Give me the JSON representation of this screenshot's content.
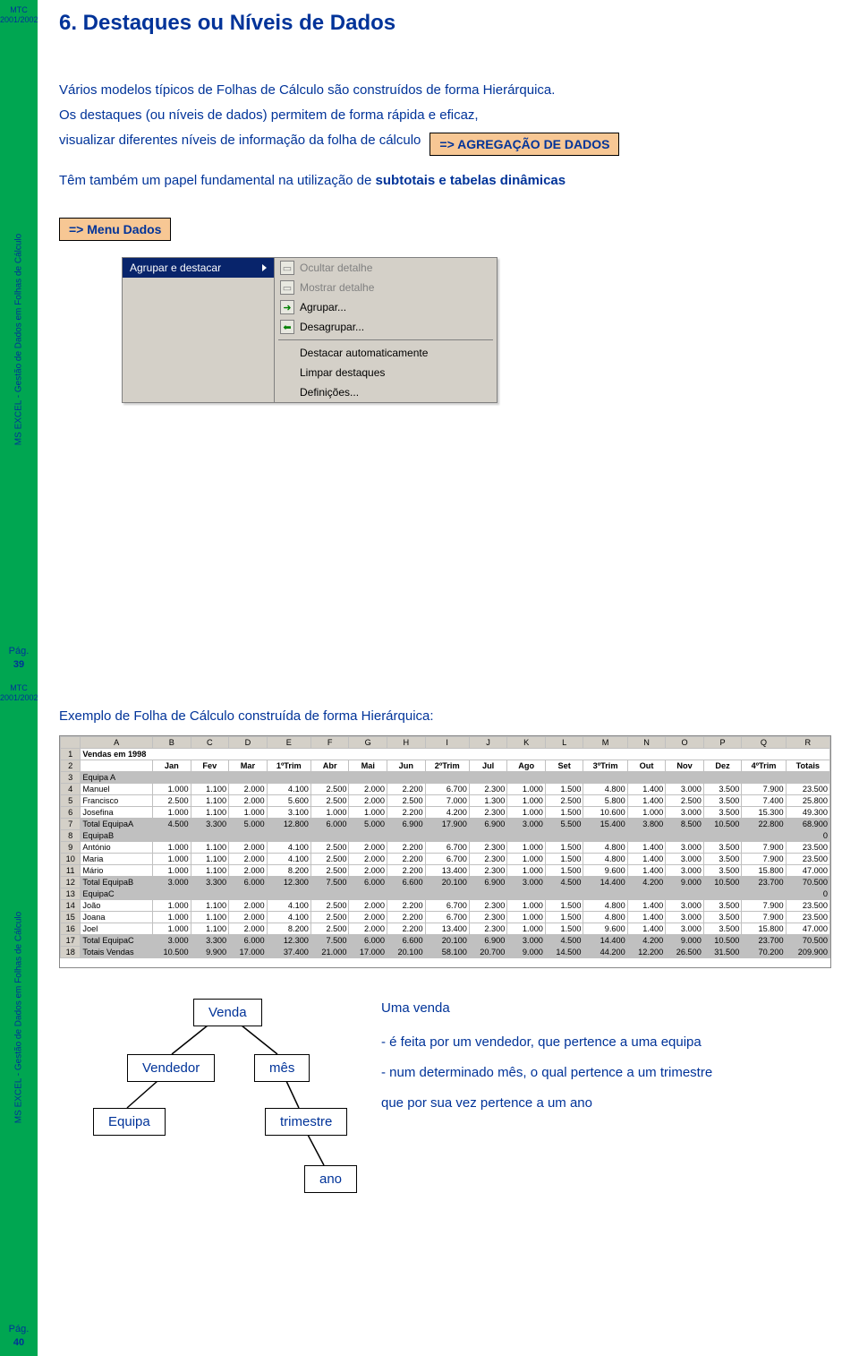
{
  "sidebar": {
    "course": "MTC",
    "year": "2001/2002",
    "subject": "MS EXCEL - Gestão de Dados em Folhas de Cálculo",
    "pag_label": "Pág."
  },
  "slide39": {
    "page": "39",
    "title": "6. Destaques ou Níveis de Dados",
    "p1": "Vários modelos típicos de Folhas de Cálculo são construídos de forma Hierárquica.",
    "p2a": "Os destaques (ou níveis de dados) permitem de forma rápida e eficaz,",
    "p2b": "visualizar diferentes níveis de informação da folha de cálculo",
    "callout_agreg": "=> AGREGAÇÃO DE DADOS",
    "p3a": "Têm também um papel fundamental na utilização de ",
    "p3b": "subtotais e tabelas dinâmicas",
    "callout_menu": "=> Menu Dados",
    "menu": {
      "left_item": "Agrupar e destacar",
      "right": {
        "ocultar": "Ocultar detalhe",
        "mostrar": "Mostrar detalhe",
        "agrupar": "Agrupar...",
        "desagrupar": "Desagrupar...",
        "destacar": "Destacar automaticamente",
        "limpar": "Limpar destaques",
        "def": "Definições..."
      }
    }
  },
  "slide40": {
    "page": "40",
    "heading": "Exemplo de Folha de Cálculo construída de forma Hierárquica:",
    "diagram": {
      "venda": "Venda",
      "vendedor": "Vendedor",
      "mes": "mês",
      "equipa": "Equipa",
      "trimestre": "trimestre",
      "ano": "ano",
      "uma_venda": "Uma venda",
      "line1": "- é feita por um vendedor, que pertence a uma equipa",
      "line2": "- num determinado mês, o qual pertence a um trimestre",
      "line3": "que por sua vez pertence a um ano"
    }
  },
  "chart_data": {
    "type": "table",
    "title": "Vendas em 1998",
    "columns": [
      "",
      "Jan",
      "Fev",
      "Mar",
      "1ºTrim",
      "Abr",
      "Mai",
      "Jun",
      "2ºTrim",
      "Jul",
      "Ago",
      "Set",
      "3ºTrim",
      "Out",
      "Nov",
      "Dez",
      "4ºTrim",
      "Totais"
    ],
    "rows": [
      {
        "n": 3,
        "label": "Equipa A",
        "grey": true,
        "vals": [
          "",
          "",
          "",
          "",
          "",
          "",
          "",
          "",
          "",
          "",
          "",
          "",
          "",
          "",
          "",
          "",
          ""
        ]
      },
      {
        "n": 4,
        "label": "Manuel",
        "vals": [
          "1.000",
          "1.100",
          "2.000",
          "4.100",
          "2.500",
          "2.000",
          "2.200",
          "6.700",
          "2.300",
          "1.000",
          "1.500",
          "4.800",
          "1.400",
          "3.000",
          "3.500",
          "7.900",
          "23.500"
        ]
      },
      {
        "n": 5,
        "label": "Francisco",
        "vals": [
          "2.500",
          "1.100",
          "2.000",
          "5.600",
          "2.500",
          "2.000",
          "2.500",
          "7.000",
          "1.300",
          "1.000",
          "2.500",
          "5.800",
          "1.400",
          "2.500",
          "3.500",
          "7.400",
          "25.800"
        ]
      },
      {
        "n": 6,
        "label": "Josefina",
        "vals": [
          "1.000",
          "1.100",
          "1.000",
          "3.100",
          "1.000",
          "1.000",
          "2.200",
          "4.200",
          "2.300",
          "1.000",
          "1.500",
          "10.600",
          "1.000",
          "3.000",
          "3.500",
          "15.300",
          "49.300"
        ]
      },
      {
        "n": 7,
        "label": "Total EquipaA",
        "grey": true,
        "vals": [
          "4.500",
          "3.300",
          "5.000",
          "12.800",
          "6.000",
          "5.000",
          "6.900",
          "17.900",
          "6.900",
          "3.000",
          "5.500",
          "15.400",
          "3.800",
          "8.500",
          "10.500",
          "22.800",
          "68.900"
        ]
      },
      {
        "n": 8,
        "label": "EquipaB",
        "grey": true,
        "vals": [
          "",
          "",
          "",
          "",
          "",
          "",
          "",
          "",
          "",
          "",
          "",
          "",
          "",
          "",
          "",
          "",
          "0"
        ]
      },
      {
        "n": 9,
        "label": "António",
        "vals": [
          "1.000",
          "1.100",
          "2.000",
          "4.100",
          "2.500",
          "2.000",
          "2.200",
          "6.700",
          "2.300",
          "1.000",
          "1.500",
          "4.800",
          "1.400",
          "3.000",
          "3.500",
          "7.900",
          "23.500"
        ]
      },
      {
        "n": 10,
        "label": "Maria",
        "vals": [
          "1.000",
          "1.100",
          "2.000",
          "4.100",
          "2.500",
          "2.000",
          "2.200",
          "6.700",
          "2.300",
          "1.000",
          "1.500",
          "4.800",
          "1.400",
          "3.000",
          "3.500",
          "7.900",
          "23.500"
        ]
      },
      {
        "n": 11,
        "label": "Mário",
        "vals": [
          "1.000",
          "1.100",
          "2.000",
          "8.200",
          "2.500",
          "2.000",
          "2.200",
          "13.400",
          "2.300",
          "1.000",
          "1.500",
          "9.600",
          "1.400",
          "3.000",
          "3.500",
          "15.800",
          "47.000"
        ]
      },
      {
        "n": 12,
        "label": "Total EquipaB",
        "grey": true,
        "vals": [
          "3.000",
          "3.300",
          "6.000",
          "12.300",
          "7.500",
          "6.000",
          "6.600",
          "20.100",
          "6.900",
          "3.000",
          "4.500",
          "14.400",
          "4.200",
          "9.000",
          "10.500",
          "23.700",
          "70.500"
        ]
      },
      {
        "n": 13,
        "label": "EquipaC",
        "grey": true,
        "vals": [
          "",
          "",
          "",
          "",
          "",
          "",
          "",
          "",
          "",
          "",
          "",
          "",
          "",
          "",
          "",
          "",
          "0"
        ]
      },
      {
        "n": 14,
        "label": "João",
        "vals": [
          "1.000",
          "1.100",
          "2.000",
          "4.100",
          "2.500",
          "2.000",
          "2.200",
          "6.700",
          "2.300",
          "1.000",
          "1.500",
          "4.800",
          "1.400",
          "3.000",
          "3.500",
          "7.900",
          "23.500"
        ]
      },
      {
        "n": 15,
        "label": "Joana",
        "vals": [
          "1.000",
          "1.100",
          "2.000",
          "4.100",
          "2.500",
          "2.000",
          "2.200",
          "6.700",
          "2.300",
          "1.000",
          "1.500",
          "4.800",
          "1.400",
          "3.000",
          "3.500",
          "7.900",
          "23.500"
        ]
      },
      {
        "n": 16,
        "label": "Joel",
        "vals": [
          "1.000",
          "1.100",
          "2.000",
          "8.200",
          "2.500",
          "2.000",
          "2.200",
          "13.400",
          "2.300",
          "1.000",
          "1.500",
          "9.600",
          "1.400",
          "3.000",
          "3.500",
          "15.800",
          "47.000"
        ]
      },
      {
        "n": 17,
        "label": "Total EquipaC",
        "grey": true,
        "vals": [
          "3.000",
          "3.300",
          "6.000",
          "12.300",
          "7.500",
          "6.000",
          "6.600",
          "20.100",
          "6.900",
          "3.000",
          "4.500",
          "14.400",
          "4.200",
          "9.000",
          "10.500",
          "23.700",
          "70.500"
        ]
      },
      {
        "n": 18,
        "label": "Totais Vendas",
        "grey": true,
        "vals": [
          "10.500",
          "9.900",
          "17.000",
          "37.400",
          "21.000",
          "17.000",
          "20.100",
          "58.100",
          "20.700",
          "9.000",
          "14.500",
          "44.200",
          "12.200",
          "26.500",
          "31.500",
          "70.200",
          "209.900"
        ]
      }
    ]
  }
}
